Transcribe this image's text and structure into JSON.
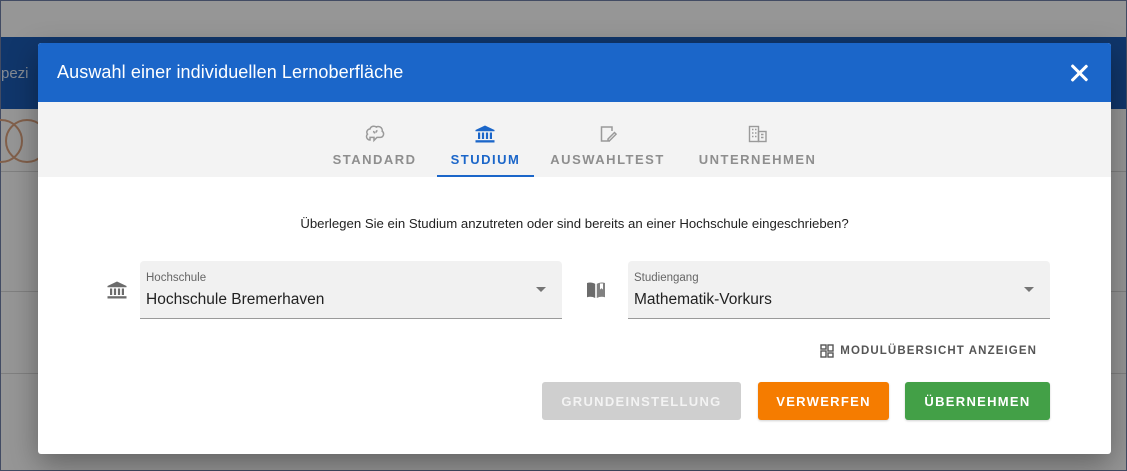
{
  "background": {
    "side_text": "pezi"
  },
  "dialog": {
    "title": "Auswahl einer individuellen Lernoberfläche",
    "tabs": [
      {
        "label": "STANDARD",
        "icon": "brain-icon"
      },
      {
        "label": "STUDIUM",
        "icon": "university-icon"
      },
      {
        "label": "AUSWAHLTEST",
        "icon": "edit-document-icon"
      },
      {
        "label": "UNTERNEHMEN",
        "icon": "office-building-icon"
      }
    ],
    "active_tab": "STUDIUM",
    "question": "Überlegen Sie ein Studium anzutreten oder sind bereits an einer Hochschule eingeschrieben?",
    "hochschule": {
      "label": "Hochschule",
      "value": "Hochschule Bremerhaven"
    },
    "studiengang": {
      "label": "Studiengang",
      "value": "Mathematik-Vorkurs"
    },
    "modul_link": "MODULÜBERSICHT ANZEIGEN",
    "buttons": {
      "grundeinstellung": "GRUNDEINSTELLUNG",
      "verwerfen": "VERWERFEN",
      "uebernehmen": "ÜBERNEHMEN"
    }
  },
  "colors": {
    "primary": "#1b66c9",
    "verwerfen": "#f57c00",
    "uebernehmen": "#43a047",
    "disabled": "#cfcfcf"
  }
}
